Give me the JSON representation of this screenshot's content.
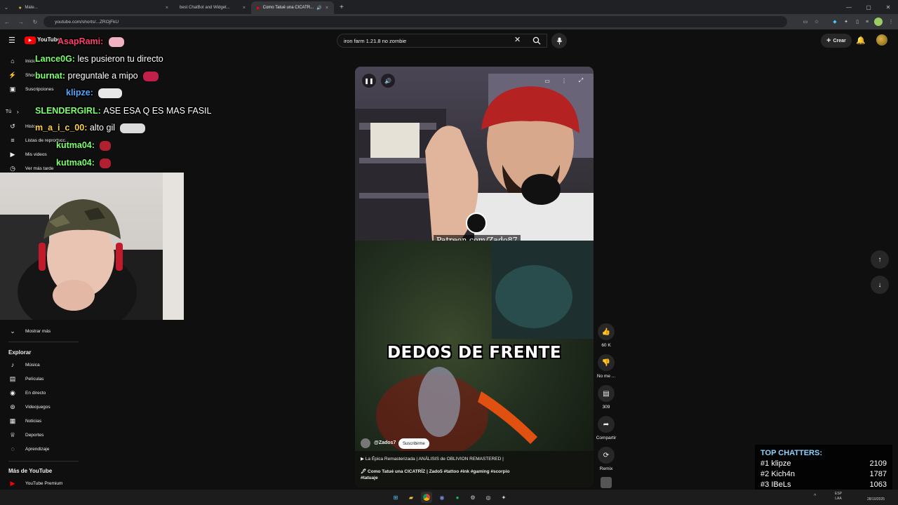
{
  "browser": {
    "tabs": [
      {
        "label": "Mate...",
        "active": false
      },
      {
        "label": "best ChatBot and Widget...",
        "active": false
      },
      {
        "label": "Como Tatué una CICATR...",
        "active": true
      }
    ],
    "url": "youtube.com/shorts/...ZROjFkU",
    "new_tab": "+",
    "close": "×"
  },
  "youtube": {
    "search_value": "iron farm 1.21.8 no zombie",
    "create_label": "Crear",
    "logo_text": "YouTube"
  },
  "sidebar": {
    "top_items": [
      {
        "label": "Inicio",
        "icon": "home-icon"
      },
      {
        "label": "Shorts",
        "icon": "shorts-icon"
      },
      {
        "label": "Suscripciones",
        "icon": "subscriptions-icon"
      }
    ],
    "you_label": "Tú",
    "you_items": [
      {
        "label": "Historial",
        "icon": "history-icon"
      },
      {
        "label": "Listas de reproducc...",
        "icon": "playlist-icon"
      },
      {
        "label": "Mis videos",
        "icon": "video-icon"
      },
      {
        "label": "Ver más tarde",
        "icon": "clock-icon"
      }
    ],
    "show_more": "Mostrar más",
    "explore_heading": "Explorar",
    "explore_items": [
      {
        "label": "Música",
        "icon": "music-icon"
      },
      {
        "label": "Películas",
        "icon": "film-icon"
      },
      {
        "label": "En directo",
        "icon": "live-icon"
      },
      {
        "label": "Videojuegos",
        "icon": "gamepad-icon"
      },
      {
        "label": "Noticias",
        "icon": "news-icon"
      },
      {
        "label": "Deportes",
        "icon": "trophy-icon"
      },
      {
        "label": "Aprendizaje",
        "icon": "bulb-icon"
      }
    ],
    "more_heading": "Más de YouTube",
    "more_items": [
      {
        "label": "YouTube Premium",
        "icon": "youtube-icon"
      }
    ]
  },
  "chat": [
    {
      "user": "AsapRami:",
      "msg": "",
      "color": "#ff3d6e"
    },
    {
      "user": "Lance0G:",
      "msg": "les pusieron tu directo",
      "color": "#7cff6b"
    },
    {
      "user": "burnat:",
      "msg": "preguntale a mipo",
      "color": "#7cff6b"
    },
    {
      "user": "klipze:",
      "msg": "",
      "color": "#4fa8ff"
    },
    {
      "user": "SLENDERGIRL:",
      "msg": "ASE ESA Q ES MAS FASIL",
      "color": "#7cff6b"
    },
    {
      "user": "m_a_i_c_00:",
      "msg": "alto gil",
      "color": "#ffd23f"
    },
    {
      "user": "kutma04:",
      "msg": "",
      "color": "#7cff6b"
    },
    {
      "user": "kutma04:",
      "msg": "",
      "color": "#7cff6b"
    }
  ],
  "short": {
    "overlay_text": "DEDOS DE FRENTE",
    "patreon_text": "Patreon.com/Zado87",
    "channel": "@Zados7",
    "subscribe_label": "Suscribirme",
    "playlist_line": "▶ La Épica Remasterizada | ANÁLISIS de OBLIVION REMASTERED |",
    "title": "🖋 Como Tatué una CICATRÍZ | Zado5 #tattoo #ink #gaming #scorpio",
    "title_line2": "#tatuaje"
  },
  "actions": [
    {
      "icon": "like-icon",
      "label": "60 K"
    },
    {
      "icon": "dislike-icon",
      "label": "No me ..."
    },
    {
      "icon": "comment-icon",
      "label": "309"
    },
    {
      "icon": "share-icon",
      "label": "Compartir"
    },
    {
      "icon": "remix-icon",
      "label": "Remix"
    }
  ],
  "top_chatters": {
    "title": "TOP CHATTERS:",
    "rows": [
      {
        "rank": "#1",
        "name": "klipze",
        "count": "2109"
      },
      {
        "rank": "#2",
        "name": "Kich4n",
        "count": "1787"
      },
      {
        "rank": "#3",
        "name": "IBeLs",
        "count": "1063"
      }
    ]
  },
  "taskbar": {
    "lang": "ESP",
    "lang2": "LAA",
    "date": "28/10/2025"
  },
  "colors": {
    "bg": "#0f0f0f",
    "accent": "#ff0000",
    "chatters_title": "#8fd3ff"
  }
}
